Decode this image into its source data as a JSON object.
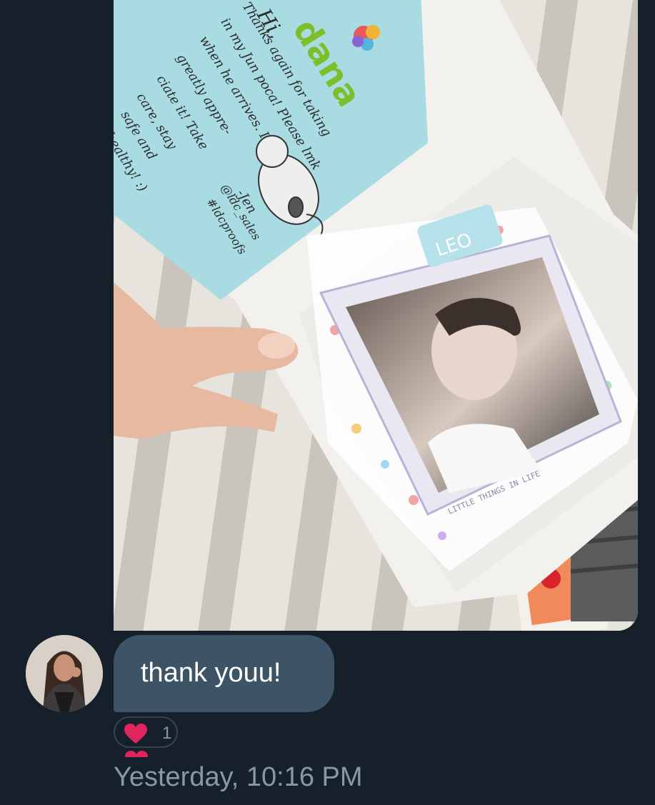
{
  "conversation": {
    "photo": {
      "note": {
        "greeting": "Hi,",
        "name": "dana",
        "lines": [
          "Thanks again for taking",
          "in my Jun poca! Please lmk",
          "when he arrives. I'd",
          "greatly appre-",
          "ciate it! Take",
          "care, stay",
          "safe and",
          "healthy! :)"
        ],
        "signature": "-Jen",
        "handle": "@ldc_sales",
        "hashtag": "#ldcproofs"
      },
      "sleeve_text": "LITTLE THINGS IN LIFE",
      "toploader_label": "LEO"
    },
    "message": {
      "text": "thank youu!"
    },
    "reaction": {
      "emoji": "heart-icon",
      "count": "1"
    },
    "timestamp": "Yesterday, 10:16 PM"
  },
  "colors": {
    "background": "#15202b",
    "bubble": "#3d5466",
    "muted_text": "#8899a6",
    "reaction_heart": "#e0245e"
  }
}
